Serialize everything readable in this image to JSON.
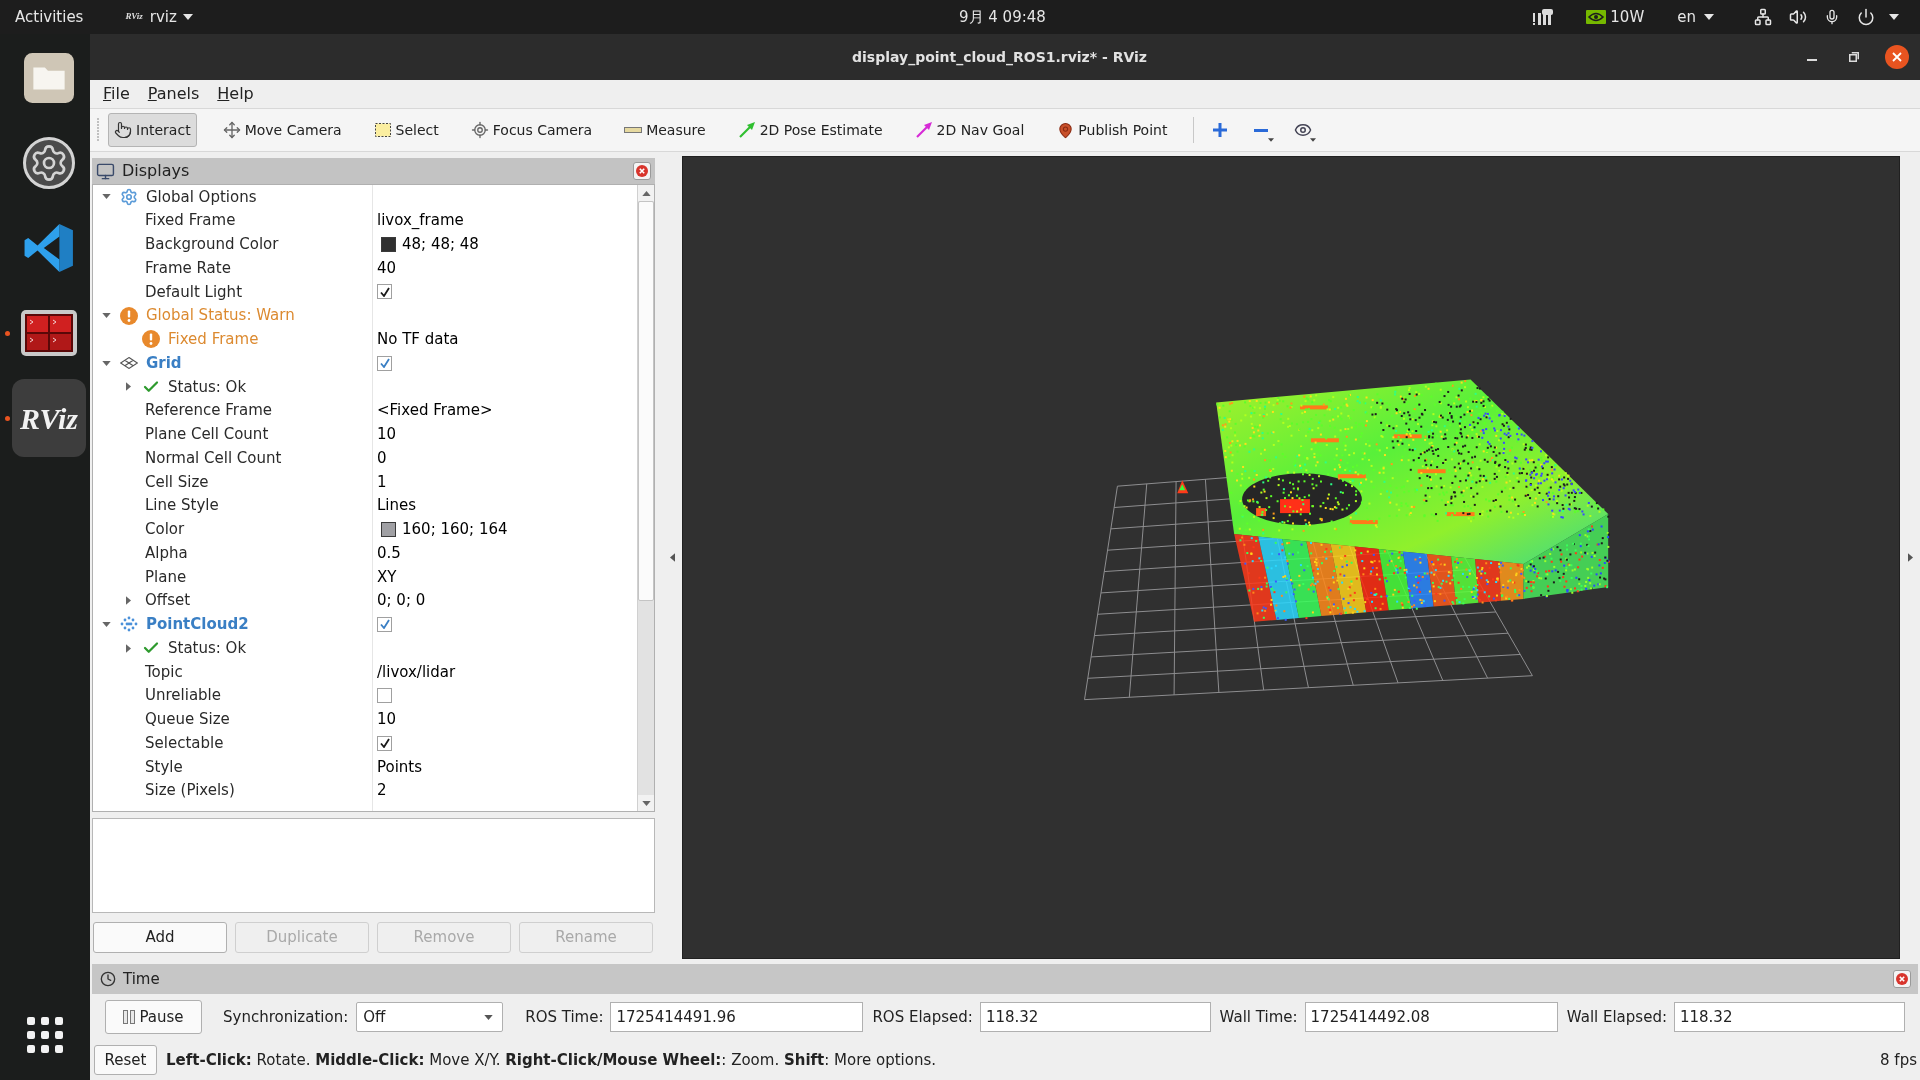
{
  "top_bar": {
    "activities": "Activities",
    "app_menu": {
      "logo": "RViz",
      "label": "rviz"
    },
    "clock": "9月 4 09:48",
    "power_draw": "10W",
    "language": "en"
  },
  "dock": {
    "items": [
      {
        "running": false,
        "selected": false
      },
      {
        "running": false,
        "selected": false
      },
      {
        "running": false,
        "selected": false
      },
      {
        "running": true,
        "selected": false
      },
      {
        "running": true,
        "selected": true,
        "logo": "RViz"
      }
    ]
  },
  "window": {
    "title": "display_point_cloud_ROS1.rviz* - RViz"
  },
  "menu": [
    "File",
    "Panels",
    "Help"
  ],
  "toolbar": {
    "tools": [
      {
        "label": "Interact",
        "selected": true
      },
      {
        "label": "Move Camera",
        "selected": false
      },
      {
        "label": "Select",
        "selected": false
      },
      {
        "label": "Focus Camera",
        "selected": false
      },
      {
        "label": "Measure",
        "selected": false
      },
      {
        "label": "2D Pose Estimate",
        "selected": false
      },
      {
        "label": "2D Nav Goal",
        "selected": false
      },
      {
        "label": "Publish Point",
        "selected": false
      }
    ]
  },
  "displays_panel": {
    "title": "Displays",
    "tree": [
      {
        "label": "Global Options",
        "kind": "options",
        "expanded": true,
        "children": [
          {
            "label": "Fixed Frame",
            "kind": "property",
            "value": "livox_frame"
          },
          {
            "label": "Background Color",
            "kind": "color",
            "value": "48; 48; 48",
            "color": "#303030"
          },
          {
            "label": "Frame Rate",
            "kind": "property",
            "value": "40"
          },
          {
            "label": "Default Light",
            "kind": "checkbox",
            "checked": true
          }
        ]
      },
      {
        "label": "Global Status: Warn",
        "kind": "warning",
        "expanded": true,
        "children": [
          {
            "label": "Fixed Frame",
            "kind": "warning",
            "value": "No TF data"
          }
        ]
      },
      {
        "label": "Grid",
        "kind": "grid",
        "expanded": true,
        "checked": true,
        "children": [
          {
            "label": "Status: Ok",
            "kind": "ok",
            "expanded": false
          },
          {
            "label": "Reference Frame",
            "kind": "property",
            "value": "<Fixed Frame>"
          },
          {
            "label": "Plane Cell Count",
            "kind": "property",
            "value": "10"
          },
          {
            "label": "Normal Cell Count",
            "kind": "property",
            "value": "0"
          },
          {
            "label": "Cell Size",
            "kind": "property",
            "value": "1"
          },
          {
            "label": "Line Style",
            "kind": "property",
            "value": "Lines"
          },
          {
            "label": "Color",
            "kind": "color",
            "value": "160; 160; 164",
            "color": "#a0a0a4"
          },
          {
            "label": "Alpha",
            "kind": "property",
            "value": "0.5"
          },
          {
            "label": "Plane",
            "kind": "property",
            "value": "XY"
          },
          {
            "label": "Offset",
            "kind": "property",
            "value": "0; 0; 0",
            "expanded": false
          }
        ]
      },
      {
        "label": "PointCloud2",
        "kind": "pointcloud",
        "expanded": true,
        "checked": true,
        "children": [
          {
            "label": "Status: Ok",
            "kind": "ok",
            "expanded": false
          },
          {
            "label": "Topic",
            "kind": "property",
            "value": "/livox/lidar"
          },
          {
            "label": "Unreliable",
            "kind": "checkbox",
            "checked": false
          },
          {
            "label": "Queue Size",
            "kind": "property",
            "value": "10"
          },
          {
            "label": "Selectable",
            "kind": "checkbox",
            "checked": true
          },
          {
            "label": "Style",
            "kind": "property",
            "value": "Points"
          },
          {
            "label": "Size (Pixels)",
            "kind": "property",
            "value": "2"
          }
        ]
      }
    ],
    "buttons": [
      {
        "label": "Add",
        "disabled": false
      },
      {
        "label": "Duplicate",
        "disabled": true
      },
      {
        "label": "Remove",
        "disabled": true
      },
      {
        "label": "Rename",
        "disabled": true
      }
    ]
  },
  "time_panel": {
    "title": "Time",
    "pause": "Pause",
    "sync_label": "Synchronization:",
    "sync_value": "Off",
    "fields": [
      {
        "label": "ROS Time:",
        "value": "1725414491.96"
      },
      {
        "label": "ROS Elapsed:",
        "value": "118.32"
      },
      {
        "label": "Wall Time:",
        "value": "1725414492.08"
      },
      {
        "label": "Wall Elapsed:",
        "value": "118.32"
      }
    ]
  },
  "status_bar": {
    "reset": "Reset",
    "hint": "**Left-Click:** Rotate. **Middle-Click:** Move X/Y. **Right-Click/Mouse Wheel:**: Zoom. **Shift**: More options.",
    "fps": "8 fps"
  }
}
